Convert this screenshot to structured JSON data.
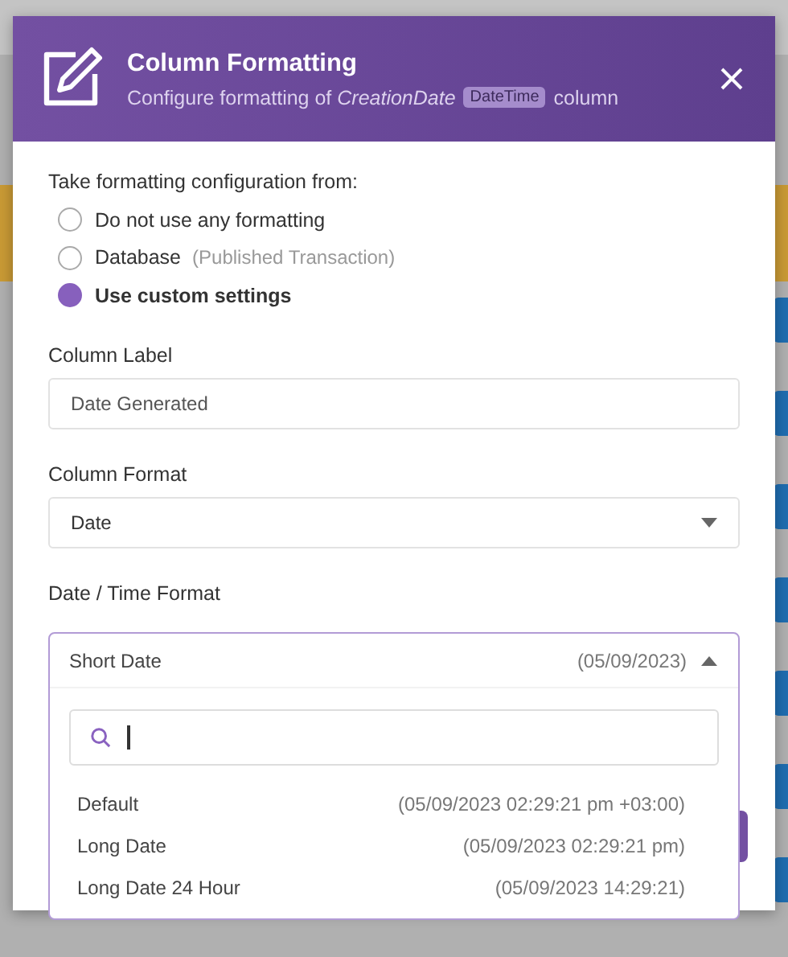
{
  "dialog": {
    "title": "Column Formatting",
    "subtitle_prefix": "Configure formatting of",
    "column_name": "CreationDate",
    "type_badge": "DateTime",
    "subtitle_suffix": "column"
  },
  "source": {
    "label": "Take formatting configuration from:",
    "options": [
      {
        "label": "Do not use any formatting",
        "selected": false
      },
      {
        "label": "Database",
        "note": "(Published Transaction)",
        "selected": false
      },
      {
        "label": "Use custom settings",
        "selected": true
      }
    ]
  },
  "column_label": {
    "label": "Column Label",
    "value": "Date Generated"
  },
  "column_format": {
    "label": "Column Format",
    "value": "Date"
  },
  "datetime_format": {
    "label": "Date / Time Format",
    "value": "Short Date",
    "preview": "(05/09/2023)",
    "expanded": true,
    "options": [
      {
        "label": "Default",
        "preview": "(05/09/2023 02:29:21 pm +03:00)"
      },
      {
        "label": "Long Date",
        "preview": "(05/09/2023 02:29:21 pm)"
      },
      {
        "label": "Long Date 24 Hour",
        "preview": "(05/09/2023 14:29:21)"
      }
    ]
  }
}
